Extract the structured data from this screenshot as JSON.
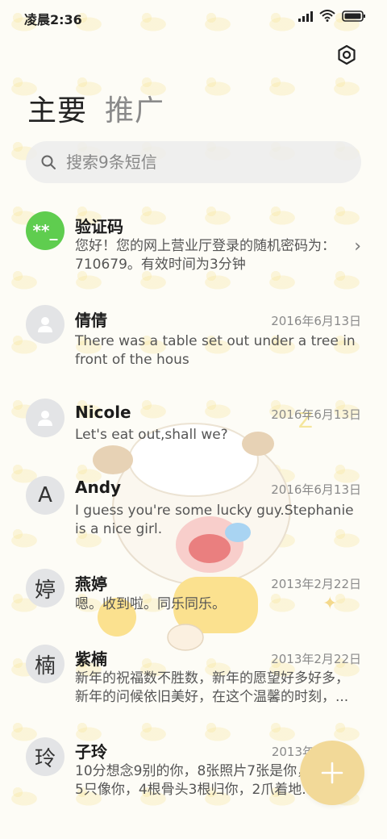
{
  "status_bar": {
    "time": "凌晨2:36",
    "icons": [
      "signal-icon",
      "wifi-icon",
      "battery-icon"
    ]
  },
  "header": {
    "settings_icon": "settings-icon",
    "tabs": [
      {
        "label": "主要",
        "active": true
      },
      {
        "label": "推广",
        "active": false
      }
    ]
  },
  "search": {
    "placeholder": "搜索9条短信"
  },
  "messages": [
    {
      "name": "验证码",
      "avatar": "**_",
      "date": "",
      "preview": "您好！您的网上营业厅登录的随机密码为：710679。有效时间为3分钟"
    },
    {
      "name": "倩倩",
      "avatar": "",
      "date": "2016年6月13日",
      "preview": "There was a table set out under a tree in front of the hous"
    },
    {
      "name": "Nicole",
      "avatar": "",
      "date": "2016年6月13日",
      "preview": "Let's eat out,shall we?"
    },
    {
      "name": "Andy",
      "avatar": "A",
      "date": "2016年6月13日",
      "preview": "I guess you're some lucky guy.Stephanie is a nice girl."
    },
    {
      "name": "燕婷",
      "avatar": "婷",
      "date": "2013年2月22日",
      "preview": "嗯。收到啦。同乐同乐。"
    },
    {
      "name": "紫楠",
      "avatar": "楠",
      "date": "2013年2月22日",
      "preview": "新年的祝福数不胜数，新年的愿望好多好多，新年的问候依旧美好，在这个温馨的时刻，..."
    },
    {
      "name": "子玲",
      "avatar": "玲",
      "date": "2013年",
      "preview": "10分想念9别的你，8张照片7张是你，6只小狗5只像你，4根骨头3根归你，2爪着地..."
    }
  ],
  "fab": {
    "icon": "plus-icon"
  },
  "colors": {
    "accent_green": "#5fcd4f",
    "fab": "#f2d998",
    "background": "#fdfcf6"
  }
}
